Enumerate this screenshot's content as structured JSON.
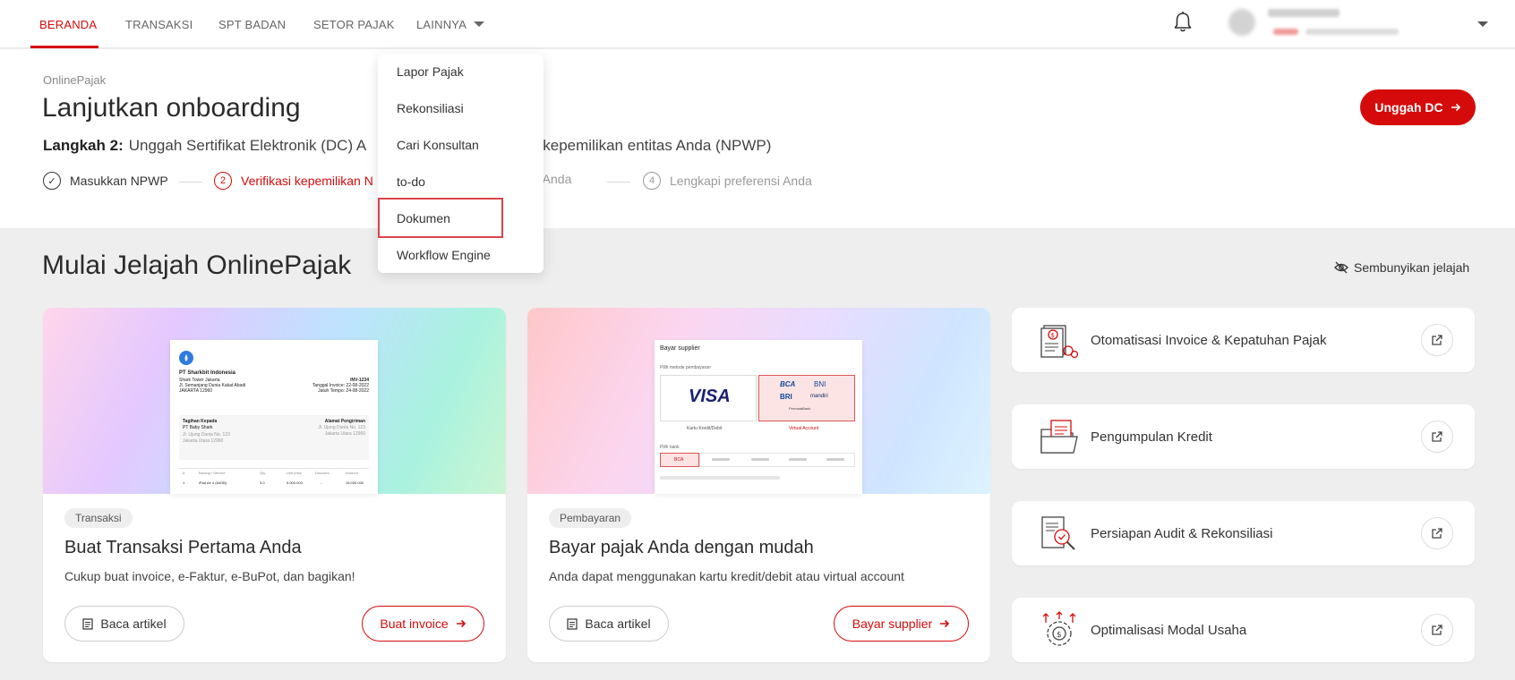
{
  "nav": {
    "items": [
      "BERANDA",
      "TRANSAKSI",
      "SPT BADAN",
      "SETOR PAJAK"
    ],
    "more_label": "LAINNYA"
  },
  "dropdown": {
    "items": [
      "Lapor Pajak",
      "Rekonsiliasi",
      "Cari Konsultan",
      "to-do",
      "Dokumen",
      "Workflow Engine"
    ],
    "highlighted": "Dokumen"
  },
  "onboarding": {
    "brand": "OnlinePajak",
    "title": "Lanjutkan onboarding",
    "step_label": "Langkah 2:",
    "step_text": "Unggah Sertifikat Elektronik (DC) A",
    "step_text_tail": "si kepemilikan entitas Anda (NPWP)",
    "steps": [
      {
        "num": "✓",
        "label": "Masukkan NPWP"
      },
      {
        "num": "2",
        "label": "Verifikasi kepemilikan N"
      },
      {
        "num": "",
        "label": "rofil Anda"
      },
      {
        "num": "4",
        "label": "Lengkapi preferensi Anda"
      }
    ],
    "cta": "Unggah DC",
    "accent": "#d50b0b"
  },
  "explore": {
    "title": "Mulai Jelajah OnlinePajak",
    "hide_label": "Sembunyikan jelajah",
    "cards": [
      {
        "tag": "Transaksi",
        "title": "Buat Transaksi Pertama Anda",
        "desc": "Cukup buat invoice, e-Faktur, e-BuPot, dan bagikan!",
        "secondary": "Baca artikel",
        "primary": "Buat invoice",
        "mock": {
          "company": "PT Sharkbit Indonesia",
          "addr1": "Shark Tower Jakarta",
          "addr2": "Jl. Semanjang Dunia Kakat Abadi",
          "addr3": "JAKARTA 12960",
          "inv_no": "INV-1234",
          "inv_date": "Tanggal Invoice: 22-08-2022",
          "due": "Jatuh Tempo: 24-08-2022",
          "bill_to": "Tagihan Kepada",
          "bill_name": "PT Baby Shark",
          "bill_addr": "Jl. Ujung Dunia No. 123",
          "bill_city": "Jakarta Utara 12960",
          "ship_to": "Alamat Pengiriman",
          "ship_addr": "Jl. Ujung Dunia No. 123",
          "ship_city": "Jakarta Utara 12960",
          "cols": [
            "#",
            "Barang / Service",
            "Qty",
            "Unit price",
            "Discount",
            "Amount"
          ],
          "row": [
            "1",
            "iPad Air 4 (64GB)",
            "3.0",
            "5.000.000",
            "-",
            "15.000.000"
          ]
        }
      },
      {
        "tag": "Pembayaran",
        "title": "Bayar pajak Anda dengan mudah",
        "desc": "Anda dapat menggunakan kartu kredit/debit atau virtual account",
        "secondary": "Baca artikel",
        "primary": "Bayar supplier",
        "mock": {
          "title": "Bayar supplier",
          "method_label": "Pilih metode pembayaran",
          "visa": "VISA",
          "banks": [
            "BCA",
            "BNI",
            "BRI",
            "mandiri",
            "PermataBank"
          ],
          "card_label": "Kartu Kredit/Debit",
          "va_label": "Virtual Account",
          "bank_label": "Pilih bank",
          "selected_bank": "BCA"
        }
      }
    ],
    "features": [
      {
        "label": "Otomatisasi Invoice & Kepatuhan Pajak",
        "icon": "invoice-icon"
      },
      {
        "label": "Pengumpulan Kredit",
        "icon": "folder-icon"
      },
      {
        "label": "Persiapan Audit & Rekonsiliasi",
        "icon": "audit-icon"
      },
      {
        "label": "Optimalisasi Modal Usaha",
        "icon": "gear-money-icon"
      }
    ]
  }
}
